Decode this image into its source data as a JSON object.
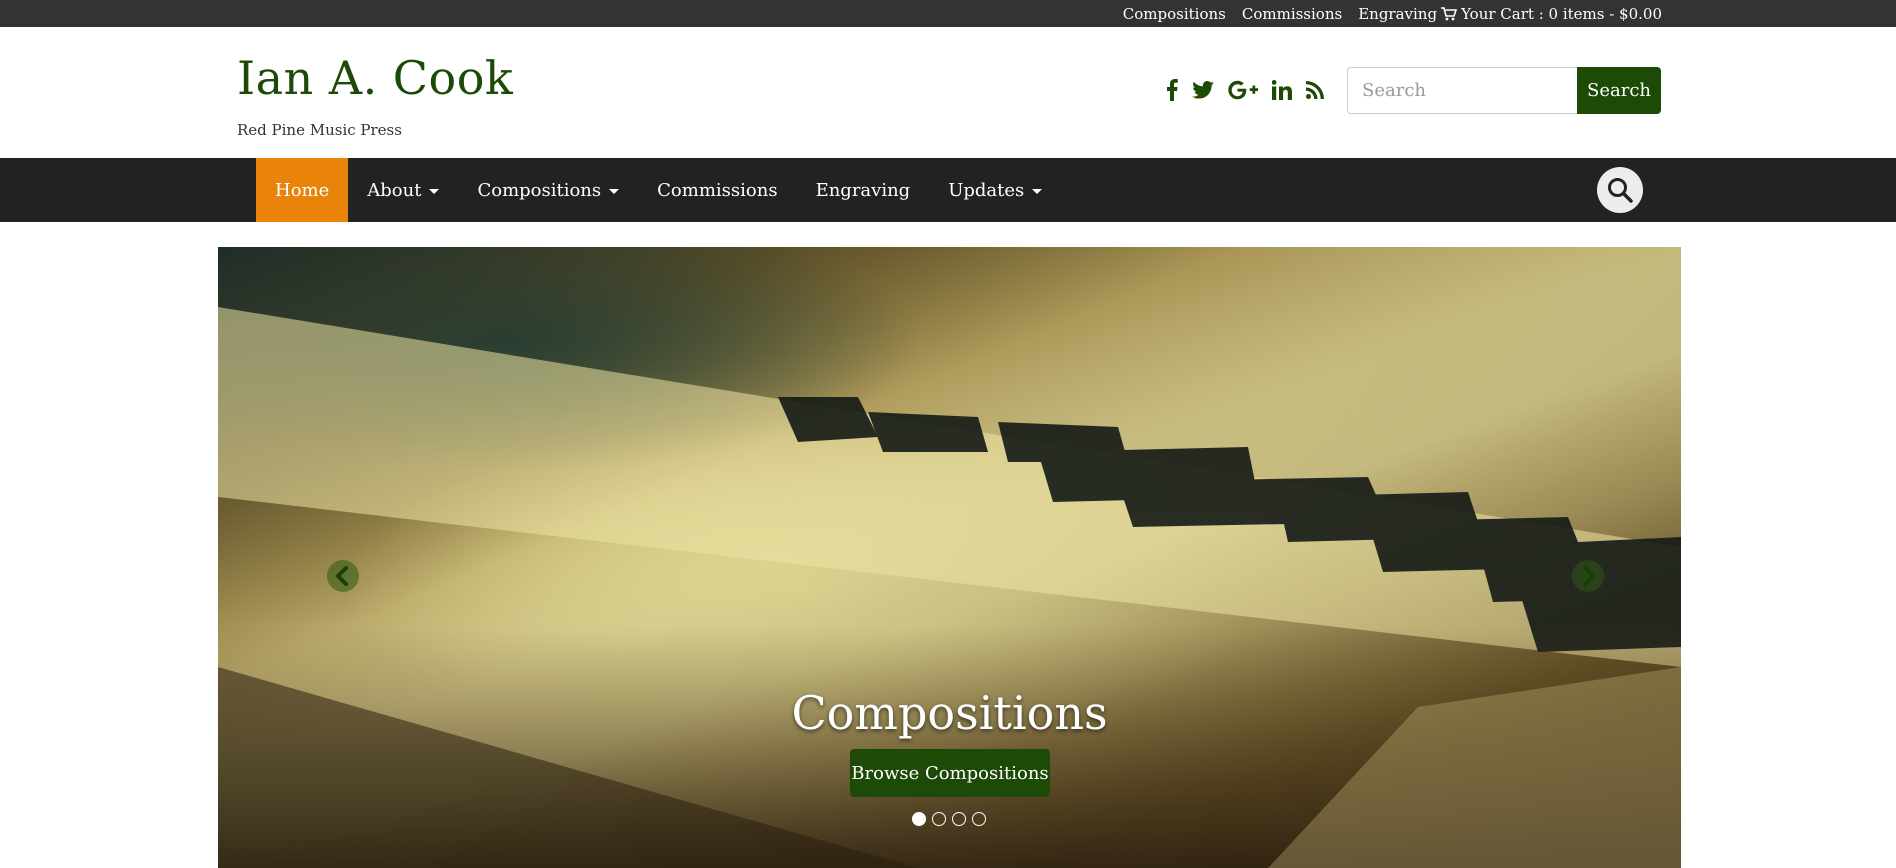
{
  "topbar": {
    "links": [
      "Compositions",
      "Commissions",
      "Engraving"
    ],
    "cart_label": "Your Cart : 0 items - $0.00"
  },
  "header": {
    "site_title": "Ian A. Cook",
    "tagline": "Red Pine Music Press",
    "social_icons": [
      "facebook-icon",
      "twitter-icon",
      "google-plus-icon",
      "linkedin-icon",
      "rss-icon"
    ],
    "search": {
      "placeholder": "Search",
      "value": "",
      "button_label": "Search"
    }
  },
  "navbar": {
    "items": [
      {
        "label": "Home",
        "active": true,
        "dropdown": false
      },
      {
        "label": "About",
        "active": false,
        "dropdown": true
      },
      {
        "label": "Compositions",
        "active": false,
        "dropdown": true
      },
      {
        "label": "Commissions",
        "active": false,
        "dropdown": false
      },
      {
        "label": "Engraving",
        "active": false,
        "dropdown": false
      },
      {
        "label": "Updates",
        "active": false,
        "dropdown": true
      }
    ]
  },
  "hero": {
    "caption": "Compositions",
    "button_label": "Browse Compositions",
    "slide_count": 4,
    "active_slide": 1
  },
  "colors": {
    "brand_green": "#1e4a07",
    "accent_orange": "#e9830a",
    "topbar_bg": "#333333",
    "navbar_bg": "#222222"
  }
}
